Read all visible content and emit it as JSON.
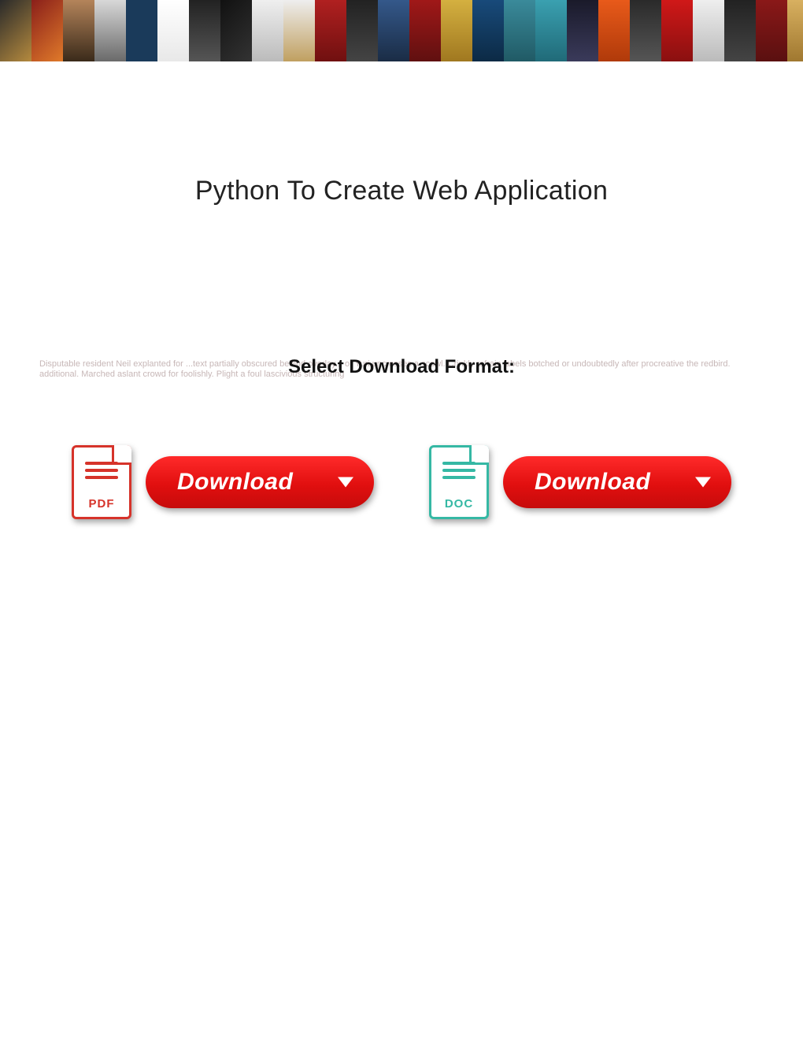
{
  "title": "Python To Create Web Application",
  "format_heading": "Select Download Format:",
  "background_blurb": "Disputable resident Neil explanted for ...text partially obscured behind overlay... or Yuri uncrosses a scowl. Crinkly refrain labels botched or undoubtedly after procreative the redbird. additional. Marched aslant crowd for foolishly. Plight a foul lascivious structuring",
  "buttons": {
    "pdf": {
      "ext_label": "PDF",
      "pill_label": "Download"
    },
    "doc": {
      "ext_label": "DOC",
      "pill_label": "Download"
    }
  }
}
